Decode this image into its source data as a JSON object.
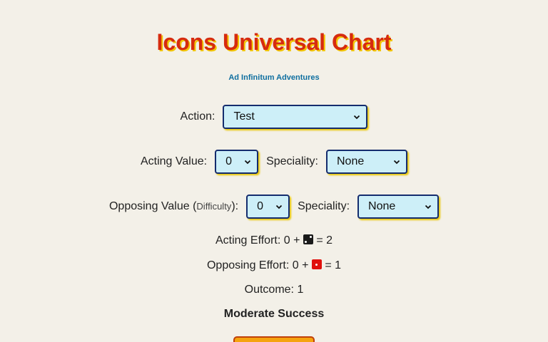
{
  "header": {
    "title": "Icons Universal Chart",
    "subtitle": "Ad Infinitum Adventures"
  },
  "action": {
    "label": "Action:",
    "selected": "Test"
  },
  "acting": {
    "label": "Acting Value:",
    "value": "0",
    "speciality_label": "Speciality:",
    "speciality": "None"
  },
  "opposing": {
    "label": "Opposing Value (",
    "label_small": "Difficulty",
    "label_end": "):",
    "value": "0",
    "speciality_label": "Speciality:",
    "speciality": "None"
  },
  "results": {
    "acting_effort_prefix": "Acting Effort: 0 +",
    "acting_effort_suffix": "= 2",
    "acting_die": {
      "icon": "die-face-2-icon",
      "color": "#1a1a1a"
    },
    "opposing_effort_prefix": "Opposing Effort: 0 +",
    "opposing_effort_suffix": "= 1",
    "opposing_die": {
      "icon": "die-face-1-icon",
      "color": "#e0100c"
    },
    "outcome": "Outcome: 1",
    "verdict": "Moderate Success"
  },
  "colors": {
    "title": "#d62b0f",
    "title_shadow": "#f2c500",
    "subtitle": "#0f6fa0",
    "select_bg": "#cdeff8",
    "select_border": "#142c6e",
    "button_bg": "#f5a30f"
  }
}
